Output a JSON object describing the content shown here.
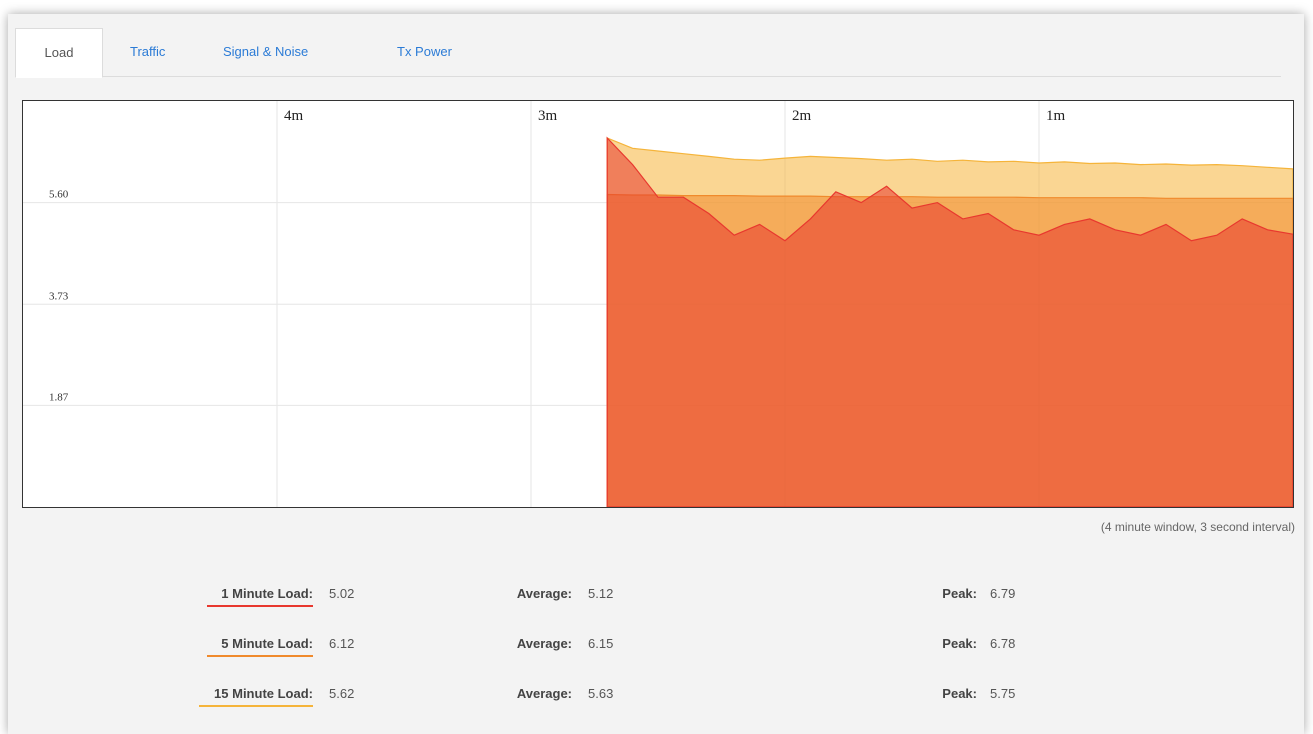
{
  "tabs": [
    {
      "label": "Load",
      "active": true
    },
    {
      "label": "Traffic",
      "active": false
    },
    {
      "label": "Signal & Noise",
      "active": false
    },
    {
      "label": "Tx Power",
      "active": false
    }
  ],
  "window_note": "(4 minute window, 3 second interval)",
  "stats": [
    {
      "label": "1 Minute Load:",
      "color": "#e8382e",
      "current": "5.02",
      "avg_label": "Average:",
      "average": "5.12",
      "peak_label": "Peak:",
      "peak": "6.79"
    },
    {
      "label": "5 Minute Load:",
      "color": "#f08a2c",
      "current": "6.12",
      "avg_label": "Average:",
      "average": "6.15",
      "peak_label": "Peak:",
      "peak": "6.78"
    },
    {
      "label": "15 Minute Load:",
      "color": "#f5b43a",
      "current": "5.62",
      "avg_label": "Average:",
      "average": "5.63",
      "peak_label": "Peak:",
      "peak": "5.75"
    }
  ],
  "chart_data": {
    "type": "area",
    "title": "",
    "xlabel": "",
    "ylabel": "",
    "ylim": [
      0,
      7.47
    ],
    "yticks": [
      "5.60",
      "3.73",
      "1.87"
    ],
    "ytick_values": [
      5.6,
      3.73,
      1.87
    ],
    "time_markers": [
      "4m",
      "3m",
      "2m",
      "1m"
    ],
    "time_marker_seconds": [
      240,
      180,
      120,
      60
    ],
    "window_seconds": 300,
    "grid": true,
    "series": [
      {
        "name": "15 Minute Load",
        "color": "#f5b43a",
        "x": [
          0,
          6,
          12,
          18,
          24,
          30,
          36,
          42,
          48,
          54,
          60,
          66,
          72,
          78,
          84,
          90,
          96,
          102,
          108,
          114,
          120,
          126,
          132,
          138,
          144,
          150,
          156,
          162
        ],
        "values": [
          6.79,
          6.6,
          6.55,
          6.5,
          6.45,
          6.4,
          6.38,
          6.42,
          6.45,
          6.43,
          6.41,
          6.38,
          6.4,
          6.36,
          6.38,
          6.35,
          6.36,
          6.33,
          6.35,
          6.32,
          6.33,
          6.3,
          6.31,
          6.29,
          6.3,
          6.28,
          6.25,
          6.22
        ]
      },
      {
        "name": "5 Minute Load",
        "color": "#f08a2c",
        "x": [
          0,
          6,
          12,
          18,
          24,
          30,
          36,
          42,
          48,
          54,
          60,
          66,
          72,
          78,
          84,
          90,
          96,
          102,
          108,
          114,
          120,
          126,
          132,
          138,
          144,
          150,
          156,
          162
        ],
        "values": [
          5.75,
          5.74,
          5.74,
          5.73,
          5.73,
          5.73,
          5.72,
          5.72,
          5.72,
          5.71,
          5.71,
          5.71,
          5.71,
          5.7,
          5.7,
          5.7,
          5.7,
          5.69,
          5.69,
          5.69,
          5.69,
          5.69,
          5.68,
          5.68,
          5.68,
          5.68,
          5.68,
          5.68
        ]
      },
      {
        "name": "1 Minute Load",
        "color": "#e8382e",
        "x": [
          0,
          6,
          12,
          18,
          24,
          30,
          36,
          42,
          48,
          54,
          60,
          66,
          72,
          78,
          84,
          90,
          96,
          102,
          108,
          114,
          120,
          126,
          132,
          138,
          144,
          150,
          156,
          162
        ],
        "values": [
          6.79,
          6.3,
          5.7,
          5.7,
          5.4,
          5.0,
          5.2,
          4.9,
          5.3,
          5.8,
          5.6,
          5.9,
          5.5,
          5.6,
          5.3,
          5.4,
          5.1,
          5.0,
          5.2,
          5.3,
          5.1,
          5.0,
          5.2,
          4.9,
          5.0,
          5.3,
          5.1,
          5.02
        ]
      }
    ]
  }
}
